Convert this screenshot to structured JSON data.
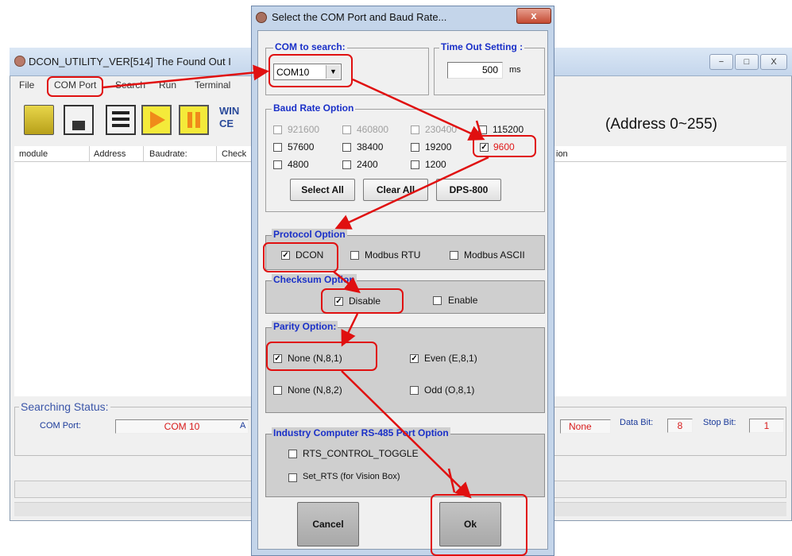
{
  "main_window": {
    "title": "DCON_UTILITY_VER[514] The Found Out I",
    "menu": [
      "File",
      "COM Port",
      "Search",
      "Run",
      "Terminal"
    ],
    "logo_text": "WIN\nCE",
    "columns": [
      "module",
      "Address",
      "Baudrate:",
      "Check"
    ],
    "right_column": "ion",
    "address_range": "(Address 0~255)",
    "status": {
      "legend": "Searching Status:",
      "com_port_label": "COM Port:",
      "com_port_value": "COM 10",
      "address_label_partial": "A",
      "parity_value": "None",
      "data_bit_label": "Data Bit:",
      "data_bit_value": "8",
      "stop_bit_label": "Stop Bit:",
      "stop_bit_value": "1"
    },
    "window_controls": [
      "−",
      "□",
      "X"
    ]
  },
  "dialog": {
    "title": "Select the COM Port and Baud Rate...",
    "close_label": "x",
    "com_group": {
      "legend": "COM to search:",
      "selected": "COM10"
    },
    "timeout_group": {
      "legend": "Time Out Setting :",
      "value": "500",
      "unit": "ms"
    },
    "baud_group": {
      "legend": "Baud Rate Option",
      "options": [
        {
          "label": "921600",
          "checked": false,
          "disabled": true
        },
        {
          "label": "460800",
          "checked": false,
          "disabled": true
        },
        {
          "label": "230400",
          "checked": false,
          "disabled": true
        },
        {
          "label": "115200",
          "checked": false,
          "disabled": false
        },
        {
          "label": "57600",
          "checked": false,
          "disabled": false
        },
        {
          "label": "38400",
          "checked": false,
          "disabled": false
        },
        {
          "label": "19200",
          "checked": false,
          "disabled": false
        },
        {
          "label": "9600",
          "checked": true,
          "disabled": false
        },
        {
          "label": "4800",
          "checked": false,
          "disabled": false
        },
        {
          "label": "2400",
          "checked": false,
          "disabled": false
        },
        {
          "label": "1200",
          "checked": false,
          "disabled": false
        }
      ],
      "buttons": [
        "Select All",
        "Clear All",
        "DPS-800"
      ]
    },
    "protocol_group": {
      "legend": "Protocol Option",
      "options": [
        {
          "label": "DCON",
          "checked": true
        },
        {
          "label": "Modbus RTU",
          "checked": false
        },
        {
          "label": "Modbus ASCII",
          "checked": false
        }
      ]
    },
    "checksum_group": {
      "legend": "Checksum  Option",
      "options": [
        {
          "label": "Disable",
          "checked": true
        },
        {
          "label": "Enable",
          "checked": false
        }
      ]
    },
    "parity_group": {
      "legend": "Parity Option:",
      "options": [
        {
          "label": "None  (N,8,1)",
          "checked": true
        },
        {
          "label": "Even  (E,8,1)",
          "checked": true
        },
        {
          "label": "None (N,8,2)",
          "checked": false
        },
        {
          "label": "Odd  (O,8,1)",
          "checked": false
        }
      ]
    },
    "rs485_group": {
      "legend": "Industry Computer RS-485 Port Option",
      "options": [
        {
          "label": "RTS_CONTROL_TOGGLE",
          "checked": false
        },
        {
          "label": "Set_RTS (for Vision Box)",
          "checked": false
        }
      ]
    },
    "cancel_label": "Cancel",
    "ok_label": "Ok"
  },
  "colors": {
    "annotation": "#e01010",
    "group_legend": "#1a30c8",
    "status_value": "#d81b1b"
  }
}
